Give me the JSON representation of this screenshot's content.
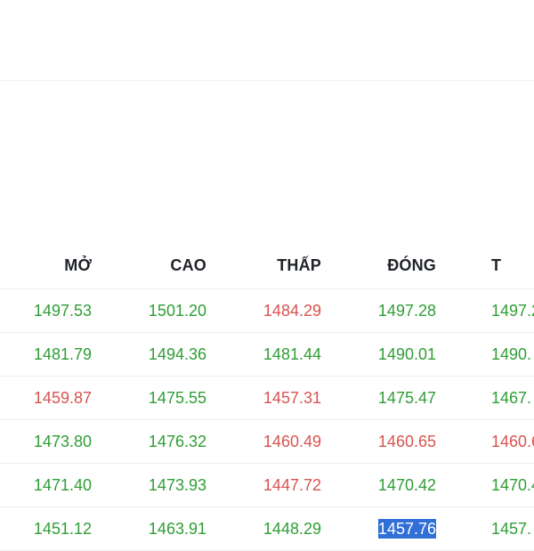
{
  "colors": {
    "up": "#2e9e35",
    "down": "#d9534f",
    "header_text": "#1f2328",
    "selection": "#2f6fd6"
  },
  "table": {
    "headers": [
      "MỞ",
      "CAO",
      "THẤP",
      "ĐÓNG",
      "T"
    ],
    "rows": [
      {
        "cells": [
          {
            "value": "1497.53",
            "trend": "up"
          },
          {
            "value": "1501.20",
            "trend": "up"
          },
          {
            "value": "1484.29",
            "trend": "down"
          },
          {
            "value": "1497.28",
            "trend": "up"
          },
          {
            "value": "1497.2",
            "trend": "up"
          }
        ]
      },
      {
        "cells": [
          {
            "value": "1481.79",
            "trend": "up"
          },
          {
            "value": "1494.36",
            "trend": "up"
          },
          {
            "value": "1481.44",
            "trend": "up"
          },
          {
            "value": "1490.01",
            "trend": "up"
          },
          {
            "value": "1490.",
            "trend": "up"
          }
        ]
      },
      {
        "cells": [
          {
            "value": "1459.87",
            "trend": "down"
          },
          {
            "value": "1475.55",
            "trend": "up"
          },
          {
            "value": "1457.31",
            "trend": "down"
          },
          {
            "value": "1475.47",
            "trend": "up"
          },
          {
            "value": "1467.",
            "trend": "up"
          }
        ]
      },
      {
        "cells": [
          {
            "value": "1473.80",
            "trend": "up"
          },
          {
            "value": "1476.32",
            "trend": "up"
          },
          {
            "value": "1460.49",
            "trend": "down"
          },
          {
            "value": "1460.65",
            "trend": "down"
          },
          {
            "value": "1460.6",
            "trend": "down"
          }
        ]
      },
      {
        "cells": [
          {
            "value": "1471.40",
            "trend": "up"
          },
          {
            "value": "1473.93",
            "trend": "up"
          },
          {
            "value": "1447.72",
            "trend": "down"
          },
          {
            "value": "1470.42",
            "trend": "up"
          },
          {
            "value": "1470.4",
            "trend": "up"
          }
        ]
      },
      {
        "cells": [
          {
            "value": "1451.12",
            "trend": "up"
          },
          {
            "value": "1463.91",
            "trend": "up"
          },
          {
            "value": "1448.29",
            "trend": "up"
          },
          {
            "value": "1457.76",
            "trend": "up",
            "selected": true
          },
          {
            "value": "1457.",
            "trend": "up"
          }
        ]
      }
    ]
  }
}
